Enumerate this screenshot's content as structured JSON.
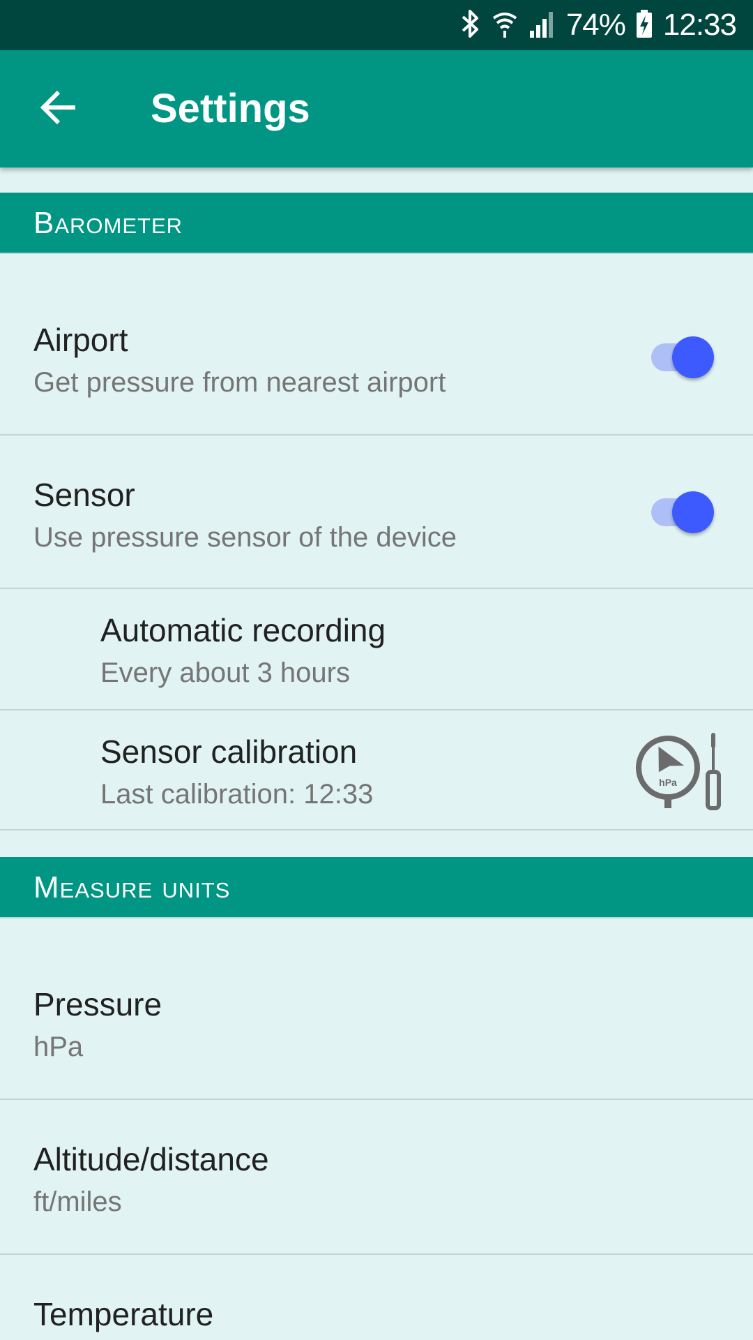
{
  "status_bar": {
    "battery_percent": "74%",
    "time": "12:33",
    "icons": [
      "bluetooth-icon",
      "wifi-icon",
      "signal-icon",
      "battery-charging-icon"
    ]
  },
  "app_bar": {
    "title": "Settings",
    "back_icon": "arrow-back-icon"
  },
  "sections": {
    "barometer": {
      "header": "Barometer",
      "airport": {
        "title": "Airport",
        "summary": "Get pressure from nearest airport",
        "enabled": true
      },
      "sensor": {
        "title": "Sensor",
        "summary": "Use pressure sensor of the device",
        "enabled": true
      },
      "automatic_recording": {
        "title": "Automatic recording",
        "summary": "Every about 3 hours"
      },
      "sensor_calibration": {
        "title": "Sensor calibration",
        "summary": "Last calibration: 12:33",
        "icon": "barometer-calibration-icon",
        "icon_text": "hPa"
      }
    },
    "measure_units": {
      "header": "Measure units",
      "pressure": {
        "title": "Pressure",
        "summary": "hPa"
      },
      "altitude": {
        "title": "Altitude/distance",
        "summary": "ft/miles"
      },
      "temperature": {
        "title": "Temperature"
      }
    }
  },
  "colors": {
    "primary": "#009683",
    "status_bar": "#00463f",
    "background": "#e1f3f2",
    "switch_accent": "#3d5afe"
  }
}
